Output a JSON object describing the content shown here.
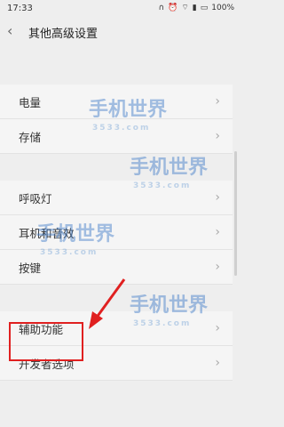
{
  "status_bar": {
    "time": "17:33",
    "battery": "100%"
  },
  "header": {
    "title": "其他高级设置"
  },
  "items": [
    {
      "label": "电量"
    },
    {
      "label": "存储"
    },
    {
      "label": "呼吸灯"
    },
    {
      "label": "耳机和音效"
    },
    {
      "label": "按键"
    },
    {
      "label": "辅助功能"
    },
    {
      "label": "开发者选项"
    }
  ],
  "watermark": {
    "brand": "手机世界",
    "site": "3533.com"
  },
  "colors": {
    "highlight": "#e02020",
    "background": "#eeeeee"
  }
}
